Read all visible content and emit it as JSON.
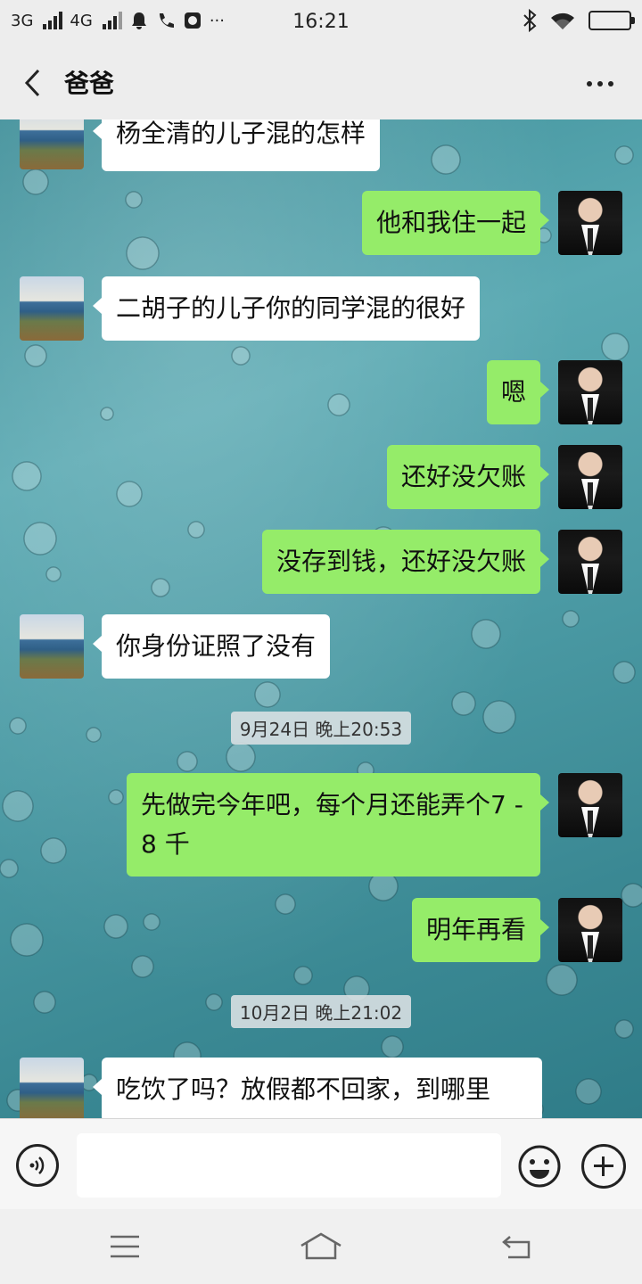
{
  "status_bar": {
    "network1": "3G",
    "network2": "4G",
    "time": "16:21",
    "more": "···"
  },
  "title_bar": {
    "title": "爸爸"
  },
  "messages": [
    {
      "side": "left",
      "text": "杨全清的儿子混的怎样"
    },
    {
      "side": "right",
      "text": "他和我住一起"
    },
    {
      "side": "left",
      "text": "二胡子的儿子你的同学混的很好"
    },
    {
      "side": "right",
      "text": "嗯"
    },
    {
      "side": "right",
      "text": "还好没欠账"
    },
    {
      "side": "right",
      "text": "没存到钱，还好没欠账"
    },
    {
      "side": "left",
      "text": "你身份证照了没有"
    },
    {
      "side": "right",
      "text": "先做完今年吧，每个月还能弄个7 - 8 千"
    },
    {
      "side": "right",
      "text": "明年再看"
    },
    {
      "side": "left",
      "text": "吃饮了吗？放假都不回家，到哪里"
    }
  ],
  "timestamps": [
    "9月24日 晚上20:53",
    "10月2日 晚上21:02"
  ],
  "input": {
    "value": "",
    "placeholder": ""
  },
  "colors": {
    "sent_bubble": "#95ec69",
    "received_bubble": "#ffffff",
    "chrome": "#ededed"
  }
}
